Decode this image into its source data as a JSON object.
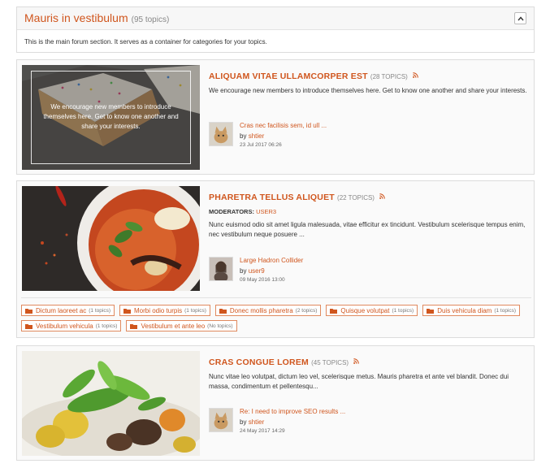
{
  "section": {
    "title": "Mauris in vestibulum",
    "count": "(95 topics)",
    "description": "This is the main forum section. It serves as a container for categories for your topics."
  },
  "categories": [
    {
      "title": "ALIQUAM VITAE ULLAMCORPER EST",
      "topics": "(28 TOPICS)",
      "overlay": "We encourage new members to introduce themselves here. Get to know one another and share your interests.",
      "description": "We encourage new members to introduce themselves here. Get to know one another and share your interests.",
      "last_topic": "Cras nec facilisis sem, id ull ...",
      "by_label": "by",
      "last_user": "shtier",
      "last_date": "23 Jul 2017 06:26"
    },
    {
      "title": "PHARETRA TELLUS ALIQUET",
      "topics": "(22 TOPICS)",
      "moderators_label": "MODERATORS:",
      "moderators": "USER3",
      "description": "Nunc euismod odio sit amet ligula malesuada, vitae efficitur ex tincidunt. Vestibulum scelerisque tempus enim, nec vestibulum neque posuere ...",
      "last_topic": "Large Hadron Collider",
      "by_label": "by",
      "last_user": "user9",
      "last_date": "09 May 2016 13:00",
      "subforums": [
        {
          "name": "Dictum laoreet ac",
          "count": "(1 topics)"
        },
        {
          "name": "Morbi odio turpis",
          "count": "(1 topics)"
        },
        {
          "name": "Donec mollis pharetra",
          "count": "(2 topics)"
        },
        {
          "name": "Quisque volutpat",
          "count": "(1 topics)"
        },
        {
          "name": "Duis vehicula diam",
          "count": "(1 topics)"
        },
        {
          "name": "Vestibulum vehicula",
          "count": "(1 topics)"
        },
        {
          "name": "Vestibulum et ante leo",
          "count": "(No topics)"
        }
      ]
    },
    {
      "title": "CRAS CONGUE LOREM",
      "topics": "(45 TOPICS)",
      "description": "Nunc vitae leo volutpat, dictum leo vel, scelerisque metus. Mauris pharetra et ante vel blandit. Donec dui massa, condimentum et pellentesqu...",
      "last_topic": "Re: I need to improve SEO results ...",
      "by_label": "by",
      "last_user": "shtier",
      "last_date": "24 May 2017 14:29"
    }
  ],
  "colors": {
    "accent": "#d0561e",
    "border": "#dcdcdc"
  },
  "icons": [
    "chevron-up-icon",
    "rss-icon",
    "folder-icon"
  ]
}
